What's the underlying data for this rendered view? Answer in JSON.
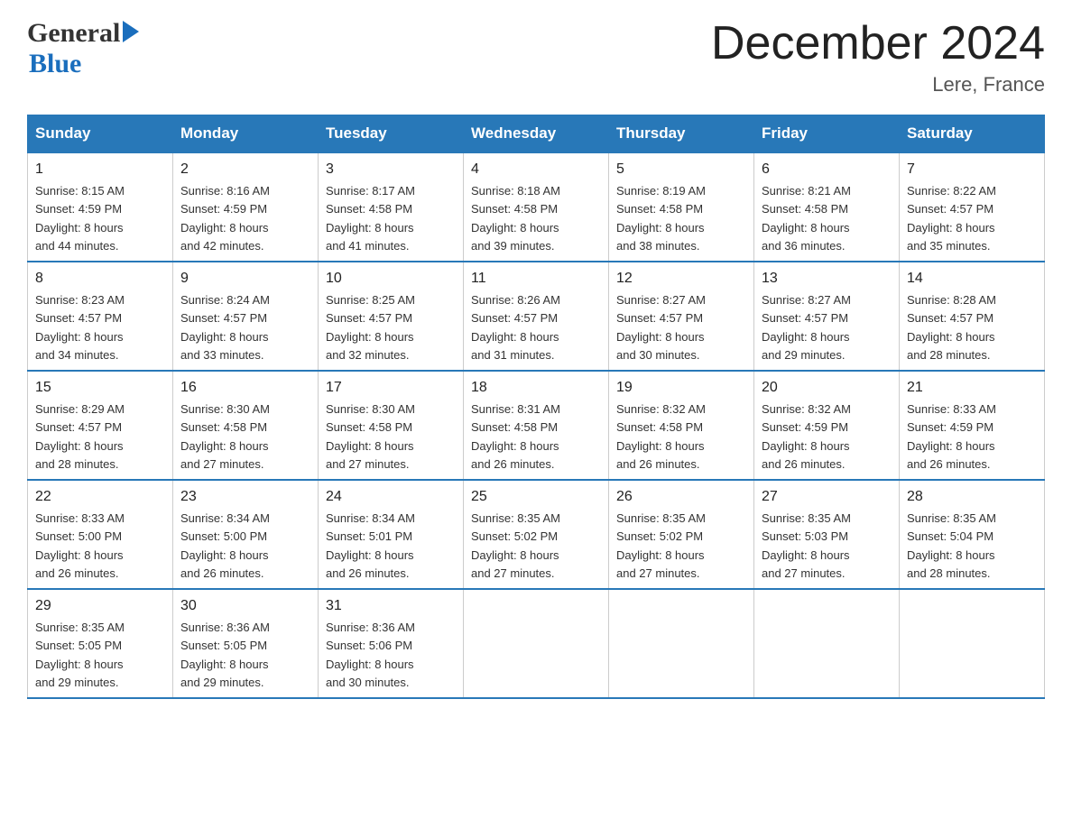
{
  "header": {
    "logo_general": "General",
    "logo_blue": "Blue",
    "month_title": "December 2024",
    "location": "Lere, France"
  },
  "days_of_week": [
    "Sunday",
    "Monday",
    "Tuesday",
    "Wednesday",
    "Thursday",
    "Friday",
    "Saturday"
  ],
  "weeks": [
    [
      {
        "num": "1",
        "sunrise": "8:15 AM",
        "sunset": "4:59 PM",
        "daylight": "8 hours and 44 minutes."
      },
      {
        "num": "2",
        "sunrise": "8:16 AM",
        "sunset": "4:59 PM",
        "daylight": "8 hours and 42 minutes."
      },
      {
        "num": "3",
        "sunrise": "8:17 AM",
        "sunset": "4:58 PM",
        "daylight": "8 hours and 41 minutes."
      },
      {
        "num": "4",
        "sunrise": "8:18 AM",
        "sunset": "4:58 PM",
        "daylight": "8 hours and 39 minutes."
      },
      {
        "num": "5",
        "sunrise": "8:19 AM",
        "sunset": "4:58 PM",
        "daylight": "8 hours and 38 minutes."
      },
      {
        "num": "6",
        "sunrise": "8:21 AM",
        "sunset": "4:58 PM",
        "daylight": "8 hours and 36 minutes."
      },
      {
        "num": "7",
        "sunrise": "8:22 AM",
        "sunset": "4:57 PM",
        "daylight": "8 hours and 35 minutes."
      }
    ],
    [
      {
        "num": "8",
        "sunrise": "8:23 AM",
        "sunset": "4:57 PM",
        "daylight": "8 hours and 34 minutes."
      },
      {
        "num": "9",
        "sunrise": "8:24 AM",
        "sunset": "4:57 PM",
        "daylight": "8 hours and 33 minutes."
      },
      {
        "num": "10",
        "sunrise": "8:25 AM",
        "sunset": "4:57 PM",
        "daylight": "8 hours and 32 minutes."
      },
      {
        "num": "11",
        "sunrise": "8:26 AM",
        "sunset": "4:57 PM",
        "daylight": "8 hours and 31 minutes."
      },
      {
        "num": "12",
        "sunrise": "8:27 AM",
        "sunset": "4:57 PM",
        "daylight": "8 hours and 30 minutes."
      },
      {
        "num": "13",
        "sunrise": "8:27 AM",
        "sunset": "4:57 PM",
        "daylight": "8 hours and 29 minutes."
      },
      {
        "num": "14",
        "sunrise": "8:28 AM",
        "sunset": "4:57 PM",
        "daylight": "8 hours and 28 minutes."
      }
    ],
    [
      {
        "num": "15",
        "sunrise": "8:29 AM",
        "sunset": "4:57 PM",
        "daylight": "8 hours and 28 minutes."
      },
      {
        "num": "16",
        "sunrise": "8:30 AM",
        "sunset": "4:58 PM",
        "daylight": "8 hours and 27 minutes."
      },
      {
        "num": "17",
        "sunrise": "8:30 AM",
        "sunset": "4:58 PM",
        "daylight": "8 hours and 27 minutes."
      },
      {
        "num": "18",
        "sunrise": "8:31 AM",
        "sunset": "4:58 PM",
        "daylight": "8 hours and 26 minutes."
      },
      {
        "num": "19",
        "sunrise": "8:32 AM",
        "sunset": "4:58 PM",
        "daylight": "8 hours and 26 minutes."
      },
      {
        "num": "20",
        "sunrise": "8:32 AM",
        "sunset": "4:59 PM",
        "daylight": "8 hours and 26 minutes."
      },
      {
        "num": "21",
        "sunrise": "8:33 AM",
        "sunset": "4:59 PM",
        "daylight": "8 hours and 26 minutes."
      }
    ],
    [
      {
        "num": "22",
        "sunrise": "8:33 AM",
        "sunset": "5:00 PM",
        "daylight": "8 hours and 26 minutes."
      },
      {
        "num": "23",
        "sunrise": "8:34 AM",
        "sunset": "5:00 PM",
        "daylight": "8 hours and 26 minutes."
      },
      {
        "num": "24",
        "sunrise": "8:34 AM",
        "sunset": "5:01 PM",
        "daylight": "8 hours and 26 minutes."
      },
      {
        "num": "25",
        "sunrise": "8:35 AM",
        "sunset": "5:02 PM",
        "daylight": "8 hours and 27 minutes."
      },
      {
        "num": "26",
        "sunrise": "8:35 AM",
        "sunset": "5:02 PM",
        "daylight": "8 hours and 27 minutes."
      },
      {
        "num": "27",
        "sunrise": "8:35 AM",
        "sunset": "5:03 PM",
        "daylight": "8 hours and 27 minutes."
      },
      {
        "num": "28",
        "sunrise": "8:35 AM",
        "sunset": "5:04 PM",
        "daylight": "8 hours and 28 minutes."
      }
    ],
    [
      {
        "num": "29",
        "sunrise": "8:35 AM",
        "sunset": "5:05 PM",
        "daylight": "8 hours and 29 minutes."
      },
      {
        "num": "30",
        "sunrise": "8:36 AM",
        "sunset": "5:05 PM",
        "daylight": "8 hours and 29 minutes."
      },
      {
        "num": "31",
        "sunrise": "8:36 AM",
        "sunset": "5:06 PM",
        "daylight": "8 hours and 30 minutes."
      },
      null,
      null,
      null,
      null
    ]
  ],
  "labels": {
    "sunrise": "Sunrise:",
    "sunset": "Sunset:",
    "daylight": "Daylight:"
  }
}
